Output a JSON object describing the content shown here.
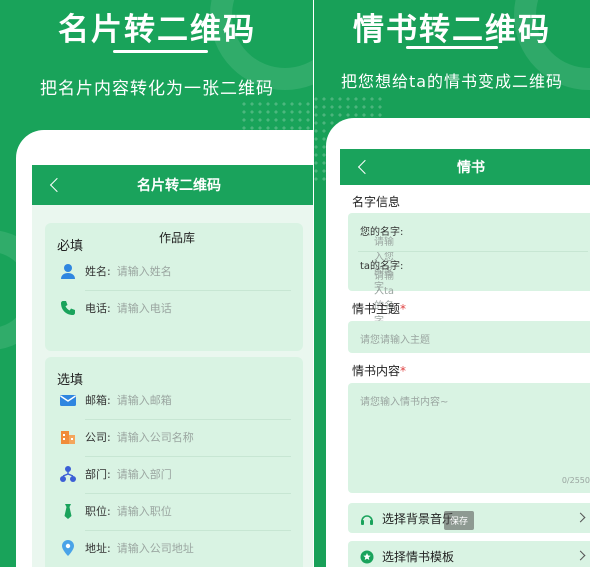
{
  "left": {
    "hero_title": "名片转二维码",
    "hero_subtitle": "把名片内容转化为一张二维码",
    "screen_title": "名片转二维码",
    "overlay_text": "作品库",
    "required": {
      "title": "必填",
      "rows": [
        {
          "label": "姓名:",
          "placeholder": "请输入姓名",
          "icon": "person-icon"
        },
        {
          "label": "电话:",
          "placeholder": "请输入电话",
          "icon": "phone-icon"
        }
      ]
    },
    "optional": {
      "title": "选填",
      "rows": [
        {
          "label": "邮箱:",
          "placeholder": "请输入邮箱",
          "icon": "mail-icon"
        },
        {
          "label": "公司:",
          "placeholder": "请输入公司名称",
          "icon": "building-icon"
        },
        {
          "label": "部门:",
          "placeholder": "请输入部门",
          "icon": "org-icon"
        },
        {
          "label": "职位:",
          "placeholder": "请输入职位",
          "icon": "tie-icon"
        },
        {
          "label": "地址:",
          "placeholder": "请输入公司地址",
          "icon": "location-icon"
        }
      ]
    }
  },
  "right": {
    "hero_title": "情书转二维码",
    "hero_subtitle": "把您想给ta的情书变成二维码",
    "screen_title": "情书",
    "name_section": {
      "title": "名字信息",
      "rows": [
        {
          "label": "您的名字:",
          "placeholder": "请输入您的名字"
        },
        {
          "label": "ta的名字:",
          "placeholder": "请输入ta的名字"
        }
      ]
    },
    "subject": {
      "label": "情书主题",
      "required_mark": "*",
      "placeholder": "请您请输入主题"
    },
    "content": {
      "label": "情书内容",
      "required_mark": "*",
      "placeholder": "请您输入情书内容~",
      "counter": "0/2550"
    },
    "options": [
      {
        "label": "选择背景音乐",
        "icon": "music-icon"
      },
      {
        "label": "选择情书模板",
        "icon": "star-icon"
      }
    ],
    "toast": "保存"
  },
  "colors": {
    "brand_green": "#19a35a",
    "card_green": "#d9f3e3",
    "required_red": "#e04343"
  }
}
